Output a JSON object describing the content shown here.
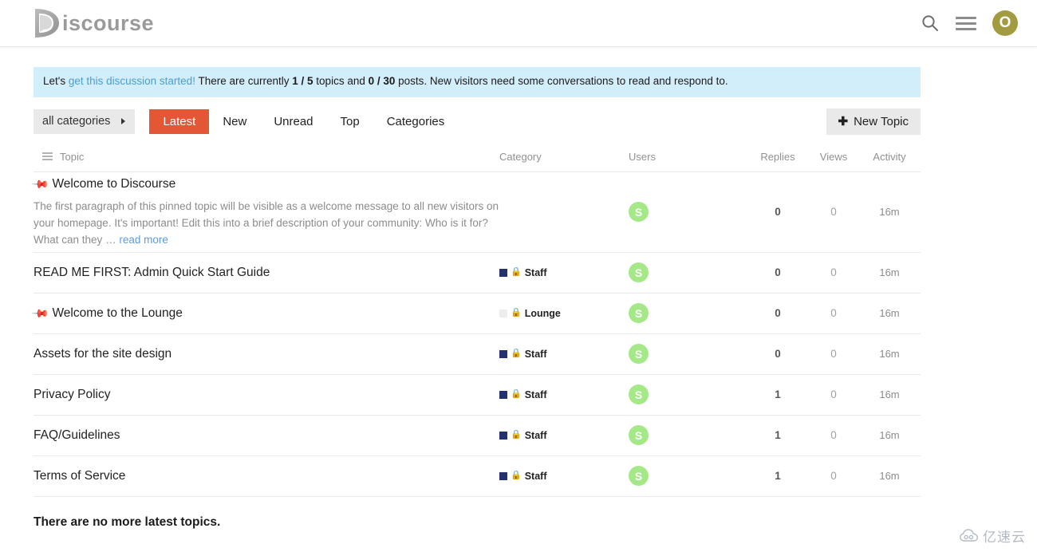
{
  "header": {
    "logo_text": "Discourse",
    "search_icon": "search-icon",
    "menu_icon": "hamburger-menu-icon",
    "avatar_letter": "O",
    "avatar_color": "#a29b3f"
  },
  "notice": {
    "prefix": "Let's ",
    "link_text": "get this discussion started!",
    "mid1": " There are currently ",
    "count_topics": "1 / 5",
    "mid2": " topics and ",
    "count_posts": "0 / 30",
    "suffix": " posts. New visitors need some conversations to read and respond to.",
    "background": "#d3eefb",
    "link_color": "#4a9ed0"
  },
  "nav": {
    "category_selector": "all categories",
    "tabs": [
      {
        "label": "Latest",
        "active": true
      },
      {
        "label": "New",
        "active": false
      },
      {
        "label": "Unread",
        "active": false
      },
      {
        "label": "Top",
        "active": false
      },
      {
        "label": "Categories",
        "active": false
      }
    ],
    "active_tab_color": "#e45735",
    "new_topic_label": "New Topic",
    "new_topic_plus": "✚"
  },
  "table": {
    "headers": {
      "topic": "Topic",
      "category": "Category",
      "users": "Users",
      "replies": "Replies",
      "views": "Views",
      "activity": "Activity"
    },
    "rows": [
      {
        "title": "Welcome to Discourse",
        "pinned": true,
        "excerpt": "The first paragraph of this pinned topic will be visible as a welcome message to all new visitors on your homepage. It's important! Edit this into a brief description of your community: Who is it for? What can they",
        "excerpt_ellipsis": "…",
        "read_more": "read more",
        "category": "",
        "category_color": "",
        "category_locked": false,
        "avatar_letter": "S",
        "replies": "0",
        "views": "0",
        "activity": "16m"
      },
      {
        "title": "READ ME FIRST: Admin Quick Start Guide",
        "pinned": false,
        "excerpt": "",
        "category": "Staff",
        "category_color": "#25306e",
        "category_locked": true,
        "avatar_letter": "S",
        "replies": "0",
        "views": "0",
        "activity": "16m"
      },
      {
        "title": "Welcome to the Lounge",
        "pinned": true,
        "excerpt": "",
        "category": "Lounge",
        "category_color": "#ededed",
        "category_locked": true,
        "avatar_letter": "S",
        "replies": "0",
        "views": "0",
        "activity": "16m"
      },
      {
        "title": "Assets for the site design",
        "pinned": false,
        "excerpt": "",
        "category": "Staff",
        "category_color": "#25306e",
        "category_locked": true,
        "avatar_letter": "S",
        "replies": "0",
        "views": "0",
        "activity": "16m"
      },
      {
        "title": "Privacy Policy",
        "pinned": false,
        "excerpt": "",
        "category": "Staff",
        "category_color": "#25306e",
        "category_locked": true,
        "avatar_letter": "S",
        "replies": "1",
        "views": "0",
        "activity": "16m"
      },
      {
        "title": "FAQ/Guidelines",
        "pinned": false,
        "excerpt": "",
        "category": "Staff",
        "category_color": "#25306e",
        "category_locked": true,
        "avatar_letter": "S",
        "replies": "1",
        "views": "0",
        "activity": "16m"
      },
      {
        "title": "Terms of Service",
        "pinned": false,
        "excerpt": "",
        "category": "Staff",
        "category_color": "#25306e",
        "category_locked": true,
        "avatar_letter": "S",
        "replies": "1",
        "views": "0",
        "activity": "16m"
      }
    ]
  },
  "footer": {
    "no_more_topics": "There are no more latest topics."
  },
  "watermark": {
    "text": "亿速云",
    "icon": "cloud-icon"
  }
}
